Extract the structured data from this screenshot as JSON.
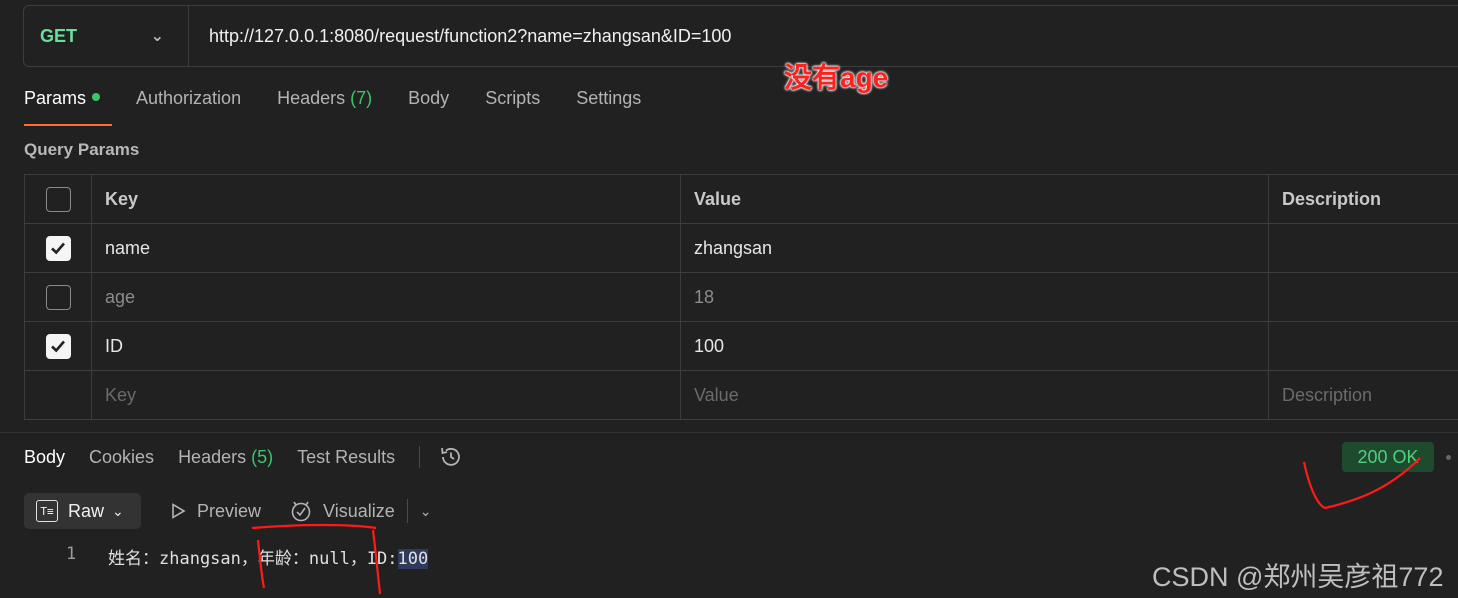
{
  "request": {
    "method": "GET",
    "url": "http://127.0.0.1:8080/request/function2?name=zhangsan&ID=100"
  },
  "annotation": "没有age",
  "request_tabs": [
    {
      "label": "Params",
      "active": true,
      "dot": true
    },
    {
      "label": "Authorization"
    },
    {
      "label": "Headers",
      "count": "(7)"
    },
    {
      "label": "Body"
    },
    {
      "label": "Scripts"
    },
    {
      "label": "Settings"
    }
  ],
  "query_params": {
    "title": "Query Params",
    "headers": {
      "key": "Key",
      "value": "Value",
      "description": "Description"
    },
    "rows": [
      {
        "checked": true,
        "key": "name",
        "value": "zhangsan"
      },
      {
        "checked": false,
        "key": "age",
        "value": "18"
      },
      {
        "checked": true,
        "key": "ID",
        "value": "100"
      }
    ],
    "placeholder": {
      "key": "Key",
      "value": "Value",
      "description": "Description"
    }
  },
  "response_tabs": [
    {
      "label": "Body",
      "active": true
    },
    {
      "label": "Cookies"
    },
    {
      "label": "Headers",
      "count": "(5)"
    },
    {
      "label": "Test Results"
    }
  ],
  "status": "200 OK",
  "view": {
    "raw": "Raw",
    "preview": "Preview",
    "visualize": "Visualize"
  },
  "response_body": {
    "line_number": "1",
    "text_before": "姓名：zhangsan，年龄：null，ID:",
    "text_highlight": "100"
  },
  "watermark": "CSDN @郑州吴彦祖772",
  "colors": {
    "accent": "#ff6c37",
    "method": "#6bdd9a",
    "status": "#4fd07f",
    "annotation": "#ff2020"
  }
}
